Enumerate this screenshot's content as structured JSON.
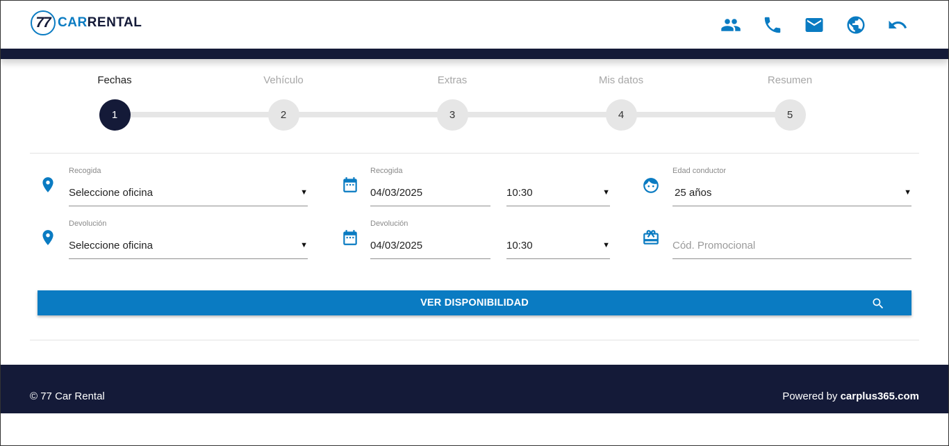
{
  "brand": {
    "logo_number": "77",
    "logo_word_a": "CAR",
    "logo_word_b": "RENTAL"
  },
  "header": {
    "icons": [
      "users-icon",
      "phone-icon",
      "mail-icon",
      "globe-icon",
      "undo-icon"
    ]
  },
  "stepper": {
    "current": 1,
    "steps": [
      {
        "label": "Fechas",
        "number": "1"
      },
      {
        "label": "Vehículo",
        "number": "2"
      },
      {
        "label": "Extras",
        "number": "3"
      },
      {
        "label": "Mis datos",
        "number": "4"
      },
      {
        "label": "Resumen",
        "number": "5"
      }
    ]
  },
  "form": {
    "pickup_office": {
      "label": "Recogida",
      "value": "Seleccione oficina"
    },
    "return_office": {
      "label": "Devolución",
      "value": "Seleccione oficina"
    },
    "pickup_date": {
      "label": "Recogida",
      "date": "04/03/2025",
      "time": "10:30"
    },
    "return_date": {
      "label": "Devolución",
      "date": "04/03/2025",
      "time": "10:30"
    },
    "driver_age": {
      "label": "Edad conductor",
      "value": "25 años"
    },
    "promo_code": {
      "placeholder": "Cód. Promocional"
    },
    "submit_label": "VER DISPONIBILIDAD"
  },
  "footer": {
    "copyright": "© 77 Car Rental",
    "powered_prefix": "Powered by ",
    "powered_brand": "carplus365.com"
  },
  "colors": {
    "accent": "#0a7bc2",
    "navy": "#141a38",
    "inactive_step": "#e6e6e6"
  }
}
